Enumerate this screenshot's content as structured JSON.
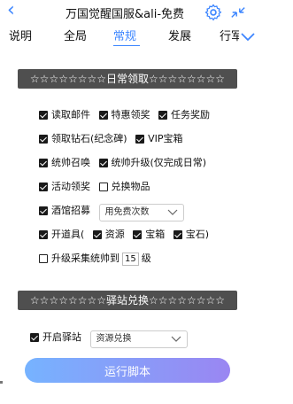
{
  "header": {
    "title": "万国觉醒国服&ali-免费",
    "back_icon": "chevron-left-icon",
    "settings_icon": "gear-icon",
    "collapse_icon": "collapse-icon"
  },
  "tabs": [
    {
      "label": "说明",
      "active": false
    },
    {
      "label": "全局",
      "active": false
    },
    {
      "label": "常规",
      "active": true
    },
    {
      "label": "发展",
      "active": false
    },
    {
      "label": "行军",
      "active": false
    }
  ],
  "sections": {
    "daily": "☆☆☆☆☆☆☆☆日常领取☆☆☆☆☆☆☆☆",
    "exchange": "☆☆☆☆☆☆☆☆驿站兑换☆☆☆☆☆☆☆☆"
  },
  "daily": {
    "read_mail": "读取邮件",
    "special_offer": "特惠领奖",
    "task_reward": "任务奖励",
    "diamond": "领取钻石(纪念碑)",
    "vip_chest": "VIP宝箱",
    "commander_summon": "统帅召唤",
    "commander_upgrade": "统帅升级(仅完成日常)",
    "event_reward": "活动领奖",
    "exchange_items": "兑换物品",
    "tavern": "酒馆招募",
    "tavern_select": "用免费次数",
    "open_items": "开道具(",
    "resources": "资源",
    "chest": "宝箱",
    "gem": "宝石)",
    "upgrade_prefix": "升级采集统帅到",
    "upgrade_level": "15",
    "upgrade_suffix": "级"
  },
  "exchange": {
    "open_post": "开启驿站",
    "select": "资源兑换"
  },
  "run_button": "运行脚本",
  "accent": "#3d86ff"
}
